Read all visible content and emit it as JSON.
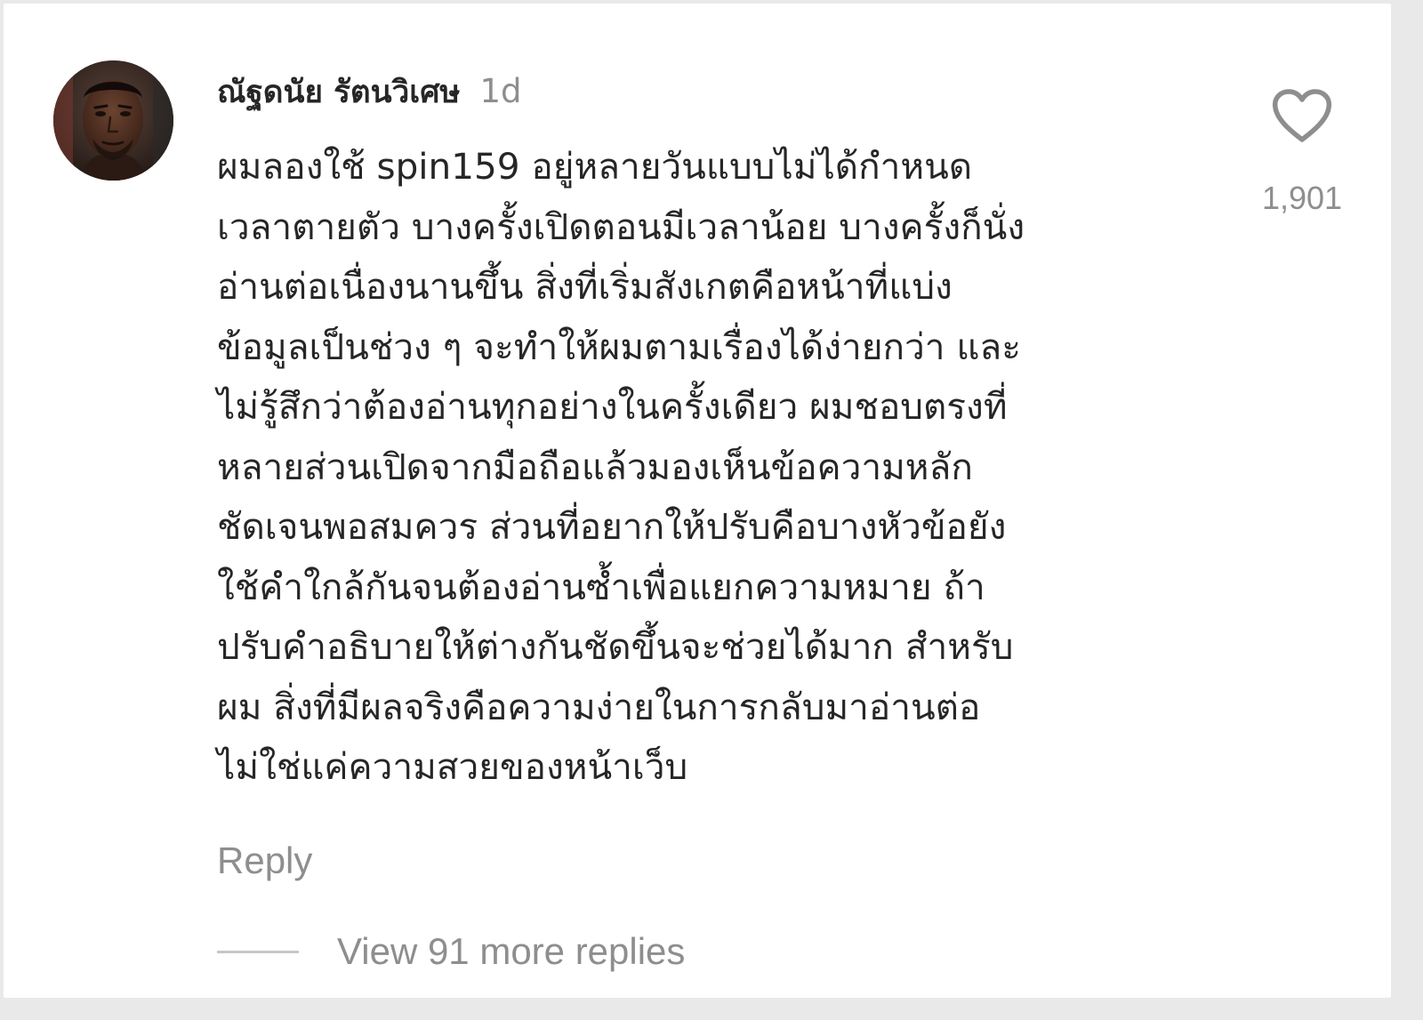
{
  "comment": {
    "author": "ณัฐดนัย รัตนวิเศษ",
    "timestamp": "1d",
    "text": "ผมลองใช้ spin159 อยู่หลายวันแบบไม่ได้กำหนด\nเวลาตายตัว บางครั้งเปิดตอนมีเวลาน้อย บางครั้งก็นั่ง\nอ่านต่อเนื่องนานขึ้น สิ่งที่เริ่มสังเกตคือหน้าที่แบ่ง\nข้อมูลเป็นช่วง ๆ จะทำให้ผมตามเรื่องได้ง่ายกว่า และ\nไม่รู้สึกว่าต้องอ่านทุกอย่างในครั้งเดียว ผมชอบตรงที่\nหลายส่วนเปิดจากมือถือแล้วมองเห็นข้อความหลัก\nชัดเจนพอสมควร ส่วนที่อยากให้ปรับคือบางหัวข้อยัง\nใช้คำใกล้กันจนต้องอ่านซ้ำเพื่อแยกความหมาย ถ้า\nปรับคำอธิบายให้ต่างกันชัดขึ้นจะช่วยได้มาก สำหรับ\nผม สิ่งที่มีผลจริงคือความง่ายในการกลับมาอ่านต่อ\nไม่ใช่แค่ความสวยของหน้าเว็บ",
    "like_count": "1,901",
    "reply_label": "Reply",
    "view_replies_label": "View 91 more replies"
  },
  "icons": {
    "like": "heart-outline-icon",
    "avatar": "profile-photo"
  },
  "colors": {
    "primary_text": "#262626",
    "secondary_text": "#8e8e8e",
    "divider": "#c7c7c7",
    "background": "#ffffff"
  }
}
